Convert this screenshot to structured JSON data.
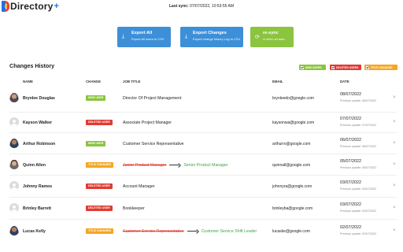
{
  "app": {
    "brand": "Directory",
    "brand_plus": "+",
    "sync_label": "Last sync:",
    "sync_value": "07/07/2022, 10:53:55 AM"
  },
  "actions": [
    {
      "title": "Export All",
      "subtitle": "Export All users to CSV",
      "icon": "download-icon"
    },
    {
      "title": "Export Changes",
      "subtitle": "Export change history Log to CSV",
      "icon": "download-icon"
    },
    {
      "title": "re-sync",
      "subtitle": "re-fetch all data",
      "icon": "refresh-icon"
    }
  ],
  "section_title": "Changes History",
  "filters": [
    {
      "label": "NEW USERS",
      "checked": true,
      "color": "#8bc43f"
    },
    {
      "label": "DELETED USERS",
      "checked": true,
      "color": "#e03b32"
    },
    {
      "label": "TITLE CHANGED",
      "checked": true,
      "color": "#f5a623"
    }
  ],
  "columns": [
    "NAME",
    "CHANGE",
    "JOB TITLE",
    "EMAIL",
    "DATE"
  ],
  "rows": [
    {
      "name": "Brynlee Douglas",
      "change": "NEW USER",
      "job_title": "Director Of Project Management",
      "old_title": "",
      "email": "brynleedo@google.com",
      "date": "08/07/2022",
      "previous": "Previous update: 08/07/2022"
    },
    {
      "name": "Kayson Walker",
      "change": "DELETED USER",
      "job_title": "Associate Project Manager",
      "old_title": "",
      "email": "kaysonwa@google.com",
      "date": "07/07/2022",
      "previous": "Previous update: 07/07/2022"
    },
    {
      "name": "Arthur Robinson",
      "change": "NEW USER",
      "job_title": "Customer Service Representative",
      "old_title": "",
      "email": "arthurro@google.com",
      "date": "06/07/2022",
      "previous": "Previous update: 06/07/2022"
    },
    {
      "name": "Quinn Allen",
      "change": "TITLE CHANGED",
      "job_title": "Senior Product Manager",
      "old_title": "Junior Product Manager",
      "email": "quinnall@google.com",
      "date": "05/07/2022",
      "previous": "Previous update: 05/07/2022"
    },
    {
      "name": "Johnny Ramos",
      "change": "DELETED USER",
      "job_title": "Account Manager",
      "old_title": "",
      "email": "johnnyra@google.com",
      "date": "03/07/2022",
      "previous": "Previous update: 03/07/2022"
    },
    {
      "name": "Brinley Barrett",
      "change": "DELETED USER",
      "job_title": "Bookkeeper",
      "old_title": "",
      "email": "brinleyba@google.com",
      "date": "03/07/2022",
      "previous": "Previous update: 03/07/2022"
    },
    {
      "name": "Lucas Kelly",
      "change": "TITLE CHANGED",
      "job_title": "Customer Service Shift Leader",
      "old_title": "Customer Service Representative",
      "email": "lucaske@google.com",
      "date": "02/07/2022",
      "previous": "Previous update: 02/07/2022"
    }
  ],
  "close_glyph": "×",
  "arrow_glyph": "→"
}
